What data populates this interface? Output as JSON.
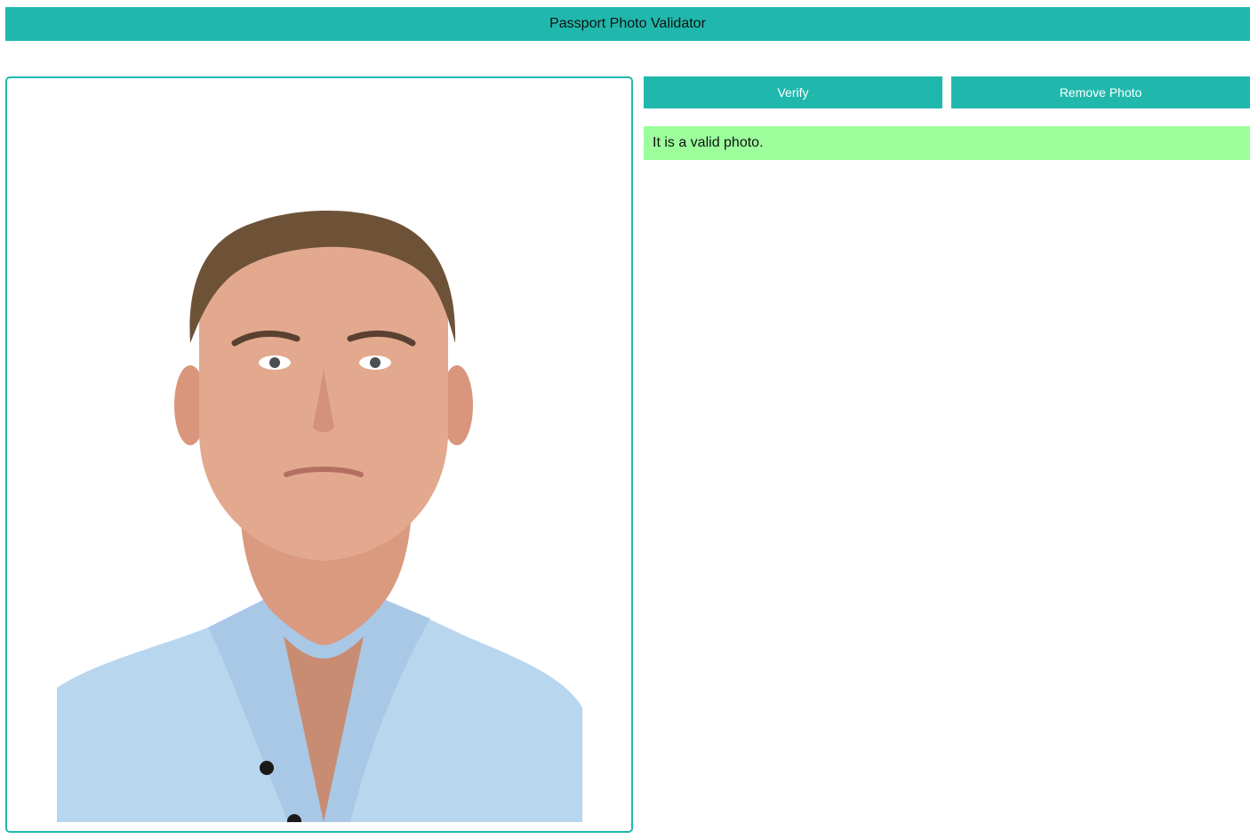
{
  "header": {
    "title": "Passport Photo Validator"
  },
  "photo": {
    "icon": "portrait-photo",
    "background_color": "#ffffff",
    "shirt_color": "#b9d6ef",
    "skin_color": "#e2a98f",
    "hair_color": "#6e5238"
  },
  "actions": {
    "verify_label": "Verify",
    "remove_label": "Remove Photo"
  },
  "result": {
    "message": "It is a valid photo.",
    "status_color": "#9cff9c"
  },
  "colors": {
    "accent": "#20b8ad"
  }
}
